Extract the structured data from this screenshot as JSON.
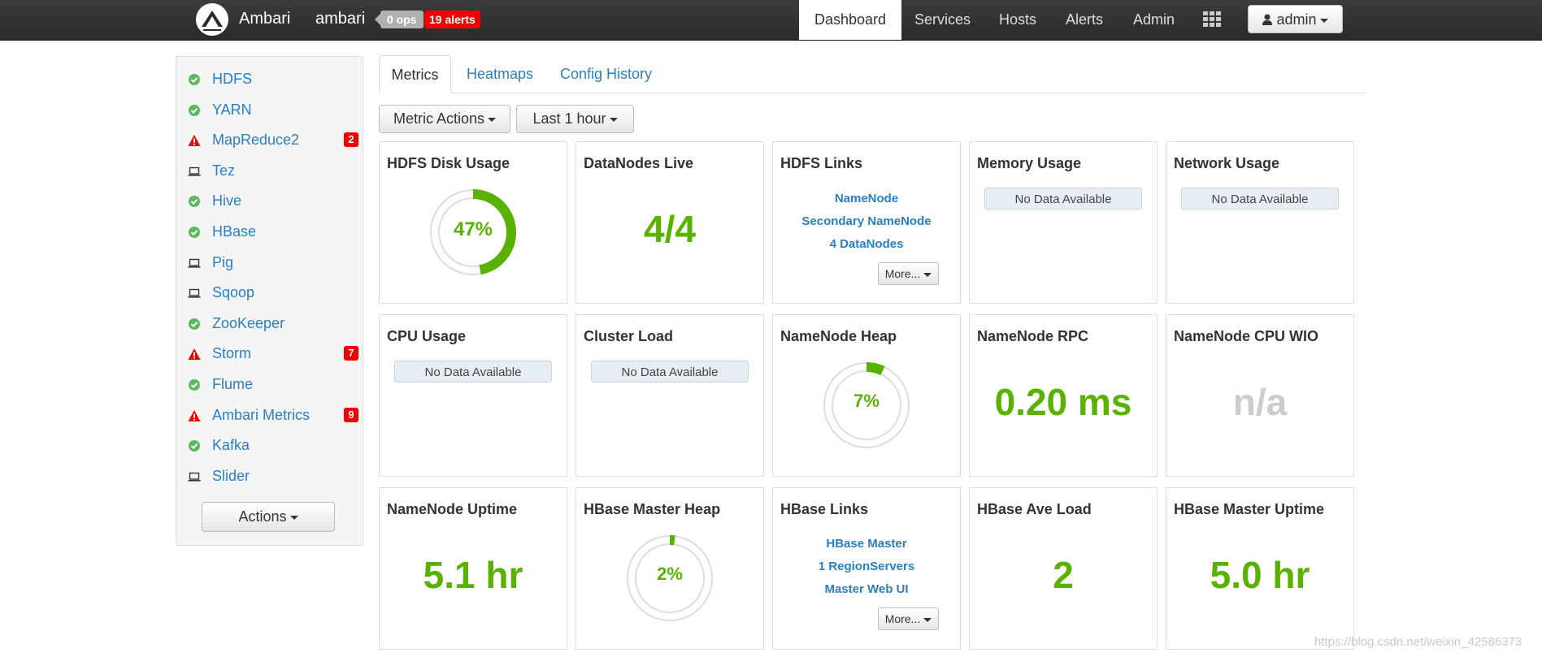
{
  "navbar": {
    "brand": "Ambari",
    "cluster": "ambari",
    "ops": "0 ops",
    "alerts": "19 alerts",
    "items": [
      "Dashboard",
      "Services",
      "Hosts",
      "Alerts",
      "Admin"
    ],
    "user": "admin"
  },
  "sidebar": {
    "services": [
      {
        "name": "HDFS",
        "status": "ok",
        "alerts": ""
      },
      {
        "name": "YARN",
        "status": "ok",
        "alerts": ""
      },
      {
        "name": "MapReduce2",
        "status": "warning",
        "alerts": "2"
      },
      {
        "name": "Tez",
        "status": "client",
        "alerts": ""
      },
      {
        "name": "Hive",
        "status": "ok",
        "alerts": ""
      },
      {
        "name": "HBase",
        "status": "ok",
        "alerts": ""
      },
      {
        "name": "Pig",
        "status": "client",
        "alerts": ""
      },
      {
        "name": "Sqoop",
        "status": "client",
        "alerts": ""
      },
      {
        "name": "ZooKeeper",
        "status": "ok",
        "alerts": ""
      },
      {
        "name": "Storm",
        "status": "warning",
        "alerts": "7"
      },
      {
        "name": "Flume",
        "status": "ok",
        "alerts": ""
      },
      {
        "name": "Ambari Metrics",
        "status": "warning",
        "alerts": "9"
      },
      {
        "name": "Kafka",
        "status": "ok",
        "alerts": ""
      },
      {
        "name": "Slider",
        "status": "client",
        "alerts": ""
      }
    ],
    "actions_label": "Actions"
  },
  "tabs": [
    "Metrics",
    "Heatmaps",
    "Config History"
  ],
  "toolbar": {
    "metric_actions": "Metric Actions",
    "time_range": "Last 1 hour"
  },
  "widgets": {
    "hdfs_disk_usage": {
      "title": "HDFS Disk Usage",
      "value": "47%",
      "percent": 47
    },
    "datanodes_live": {
      "title": "DataNodes Live",
      "value": "4/4"
    },
    "hdfs_links": {
      "title": "HDFS Links",
      "links": [
        "NameNode",
        "Secondary NameNode",
        "4 DataNodes"
      ],
      "more": "More..."
    },
    "memory_usage": {
      "title": "Memory Usage",
      "nodata": "No Data Available"
    },
    "network_usage": {
      "title": "Network Usage",
      "nodata": "No Data Available"
    },
    "cpu_usage": {
      "title": "CPU Usage",
      "nodata": "No Data Available"
    },
    "cluster_load": {
      "title": "Cluster Load",
      "nodata": "No Data Available"
    },
    "namenode_heap": {
      "title": "NameNode Heap",
      "value": "7%",
      "percent": 7
    },
    "namenode_rpc": {
      "title": "NameNode RPC",
      "value": "0.20 ms"
    },
    "namenode_cpu_wio": {
      "title": "NameNode CPU WIO",
      "value": "n/a"
    },
    "namenode_uptime": {
      "title": "NameNode Uptime",
      "value": "5.1 hr"
    },
    "hbase_master_heap": {
      "title": "HBase Master Heap",
      "value": "2%",
      "percent": 2
    },
    "hbase_links": {
      "title": "HBase Links",
      "links": [
        "HBase Master",
        "1 RegionServers",
        "Master Web UI"
      ],
      "more": "More..."
    },
    "hbase_ave_load": {
      "title": "HBase Ave Load",
      "value": "2"
    },
    "hbase_master_uptime": {
      "title": "HBase Master Uptime",
      "value": "5.0 hr"
    }
  },
  "watermark": "https://blog.csdn.net/weixin_42586373",
  "colors": {
    "ok": "#5cb85c",
    "alert": "#ee0000",
    "link": "#2a7fc0",
    "value": "#59b200"
  }
}
